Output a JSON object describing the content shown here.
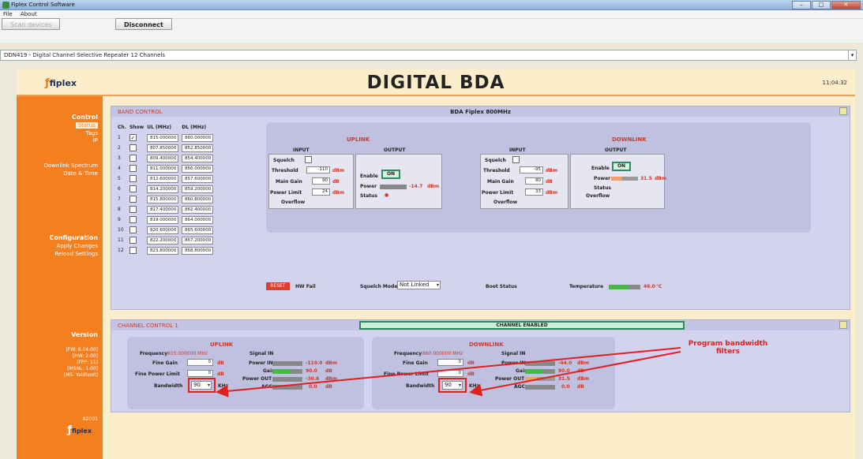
{
  "window": {
    "title": "Fiplex Control Software",
    "buttons": [
      "–",
      "□",
      "✕"
    ]
  },
  "menu": [
    "File",
    "About"
  ],
  "toolbar": {
    "scan_label": "Scan devices",
    "disconnect_label": "Disconnect"
  },
  "path": "DDN419 - Digital Channel Selective Repeater 12 Channels",
  "header": {
    "title": "DIGITAL BDA",
    "clock": "11:04:32",
    "logo_text": "fiplex"
  },
  "sidebar": {
    "control": "Control",
    "status": "Status",
    "tags": "Tags",
    "ip": "IP",
    "downlink_spectrum": "Downlink Spectrum",
    "date_time": "Date & Time",
    "configuration": "Configuration",
    "apply_changes": "Apply Changes",
    "reload_settings": "Reload Settings",
    "version": "Version",
    "version_lines": [
      "[FW: 8.04.00]",
      "[HW: 2.00]",
      "[FPP: 11]",
      "[MSNL: 1.00]",
      "[MS: Yaldhoot]"
    ],
    "serial": "82001"
  },
  "band_panel": {
    "title": "BAND CONTROL",
    "center": "BDA Fiplex 800MHz",
    "columns": [
      "Ch.",
      "Show",
      "UL (MHz)",
      "DL (MHz)"
    ],
    "channels": [
      {
        "ch": "1",
        "show": true,
        "ul": "815.000000",
        "dl": "860.000000"
      },
      {
        "ch": "2",
        "show": false,
        "ul": "807.850000",
        "dl": "852.850000"
      },
      {
        "ch": "3",
        "show": false,
        "ul": "809.400000",
        "dl": "854.400000"
      },
      {
        "ch": "4",
        "show": false,
        "ul": "811.000000",
        "dl": "856.000000"
      },
      {
        "ch": "5",
        "show": false,
        "ul": "812.600000",
        "dl": "857.600000"
      },
      {
        "ch": "6",
        "show": false,
        "ul": "814.200000",
        "dl": "859.200000"
      },
      {
        "ch": "7",
        "show": false,
        "ul": "815.800000",
        "dl": "860.800000"
      },
      {
        "ch": "8",
        "show": false,
        "ul": "817.400000",
        "dl": "862.400000"
      },
      {
        "ch": "9",
        "show": false,
        "ul": "819.000000",
        "dl": "864.000000"
      },
      {
        "ch": "10",
        "show": false,
        "ul": "820.600000",
        "dl": "865.600000"
      },
      {
        "ch": "11",
        "show": false,
        "ul": "822.200000",
        "dl": "867.200000"
      },
      {
        "ch": "12",
        "show": false,
        "ul": "823.800000",
        "dl": "868.800000"
      }
    ],
    "uplink": {
      "title": "UPLINK",
      "input": "INPUT",
      "output": "OUTPUT",
      "squelch": "Squelch",
      "threshold": "Threshold",
      "threshold_val": "-110",
      "main_gain": "Main Gain",
      "main_gain_val": "90",
      "power_limit": "Power Limit",
      "power_limit_val": "24",
      "overflow": "Overflow",
      "enable": "Enable",
      "on": "ON",
      "power": "Power",
      "power_val": "-14.7",
      "status": "Status",
      "unit_dbm": "dBm",
      "unit_db": "dB"
    },
    "downlink": {
      "title": "DOWNLINK",
      "input": "INPUT",
      "output": "OUTPUT",
      "squelch": "Squelch",
      "threshold": "Threshold",
      "threshold_val": "-95",
      "main_gain": "Main Gain",
      "main_gain_val": "80",
      "power_limit": "Power Limit",
      "power_limit_val": "33",
      "overflow": "Overflow",
      "enable": "Enable",
      "on": "ON",
      "power": "Power",
      "power_val": "31.5",
      "status": "Status",
      "overflow2": "Overflow",
      "unit_dbm": "dBm",
      "unit_db": "dB"
    },
    "reset": "RESET",
    "hw_fail": "HW Fail",
    "squelch_mode": "Squelch Mode",
    "squelch_mode_val": "Not Linked",
    "boot_status": "Boot Status",
    "temperature": "Temperature",
    "temperature_val": "46.0",
    "temp_unit": "°C"
  },
  "channel_panel": {
    "title": "CHANNEL CONTROL 1",
    "banner": "CHANNEL ENABLED",
    "uplink": {
      "title": "UPLINK",
      "frequency": "Frequency",
      "frequency_val": "815.000000 MHz",
      "fine_gain": "Fine Gain",
      "fine_gain_val": "0",
      "fine_power_limit": "Fine Power Limit",
      "fine_power_limit_val": "0",
      "bandwidth": "Bandwidth",
      "bandwidth_val": "90",
      "khz": "KHz",
      "signal_in": "Signal IN",
      "power_in": "Power IN",
      "power_in_val": "-110.0",
      "gain": "Gain",
      "gain_val": "90.0",
      "power_out": "Power OUT",
      "power_out_val": "-30.6",
      "agc": "AGC",
      "agc_val": "0.0",
      "unit_dbm": "dBm",
      "unit_db": "dB"
    },
    "downlink": {
      "title": "DOWNLINK",
      "frequency": "Frequency",
      "frequency_val": "860.000000 MHz",
      "fine_gain": "Fine Gain",
      "fine_gain_val": "0",
      "fine_power_limit": "Fine Power Limit",
      "fine_power_limit_val": "0",
      "bandwidth": "Bandwidth",
      "bandwidth_val": "90",
      "khz": "KHz",
      "signal_in": "Signal IN",
      "power_in": "Power IN",
      "power_in_val": "-44.0",
      "gain": "Gain",
      "gain_val": "80.0",
      "power_out": "Power OUT",
      "power_out_val": "31.5",
      "agc": "AGC",
      "agc_val": "0.0",
      "unit_dbm": "dBm",
      "unit_db": "dB"
    }
  },
  "annotation": {
    "line1": "Program bandwidth",
    "line2": "filters",
    "color": "#e02020"
  },
  "colors": {
    "sidebar": "#f47f1f",
    "header_bg": "#fdeecb",
    "panel_bg": "#d3d3ef",
    "enabled_green": "#cfeed7"
  }
}
